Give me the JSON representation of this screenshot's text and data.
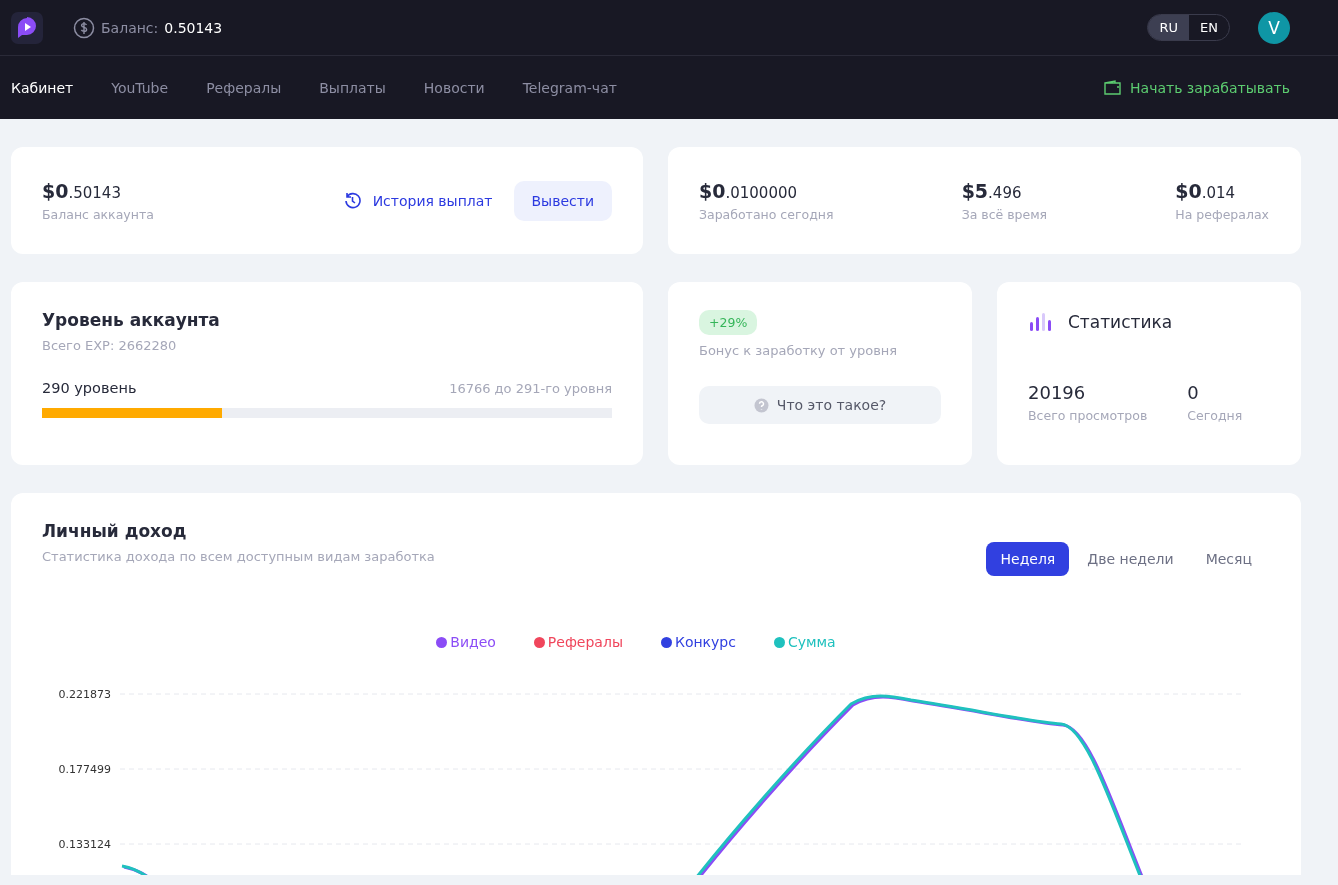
{
  "header": {
    "balance_label": "Баланс:",
    "balance_value": "0.50143",
    "languages": [
      {
        "label": "RU",
        "selected": true
      },
      {
        "label": "EN",
        "selected": false
      }
    ],
    "avatar": "V"
  },
  "nav": {
    "items": [
      {
        "label": "Кабинет",
        "selected": true
      },
      {
        "label": "YouTube",
        "selected": false
      },
      {
        "label": "Рефералы",
        "selected": false
      },
      {
        "label": "Выплаты",
        "selected": false
      },
      {
        "label": "Новости",
        "selected": false
      },
      {
        "label": "Telegram-чат",
        "selected": false
      }
    ],
    "cta": "Начать зарабатывать"
  },
  "balance_card": {
    "whole": "$0",
    "fraction": ".50143",
    "caption": "Баланс аккаунта",
    "history_link": "История выплат",
    "withdraw_button": "Вывести"
  },
  "earnings": [
    {
      "whole": "$0",
      "fraction": ".0100000",
      "caption": "Заработано сегодня"
    },
    {
      "whole": "$5",
      "fraction": ".496",
      "caption": "За всё время"
    },
    {
      "whole": "$0",
      "fraction": ".014",
      "caption": "На рефералах"
    }
  ],
  "level_card": {
    "title": "Уровень аккаунта",
    "exp": "Всего EXP: 2662280",
    "level_label": "290 уровень",
    "remaining": "16766 до 291-го уровня",
    "level": 0.316
  },
  "bonus_card": {
    "badge": "+29%",
    "caption": "Бонус к заработку от уровня",
    "help_button": "Что это такое?"
  },
  "stats_card": {
    "title": "Статистика",
    "items": [
      {
        "value": "20196",
        "caption": "Всего просмотров"
      },
      {
        "value": "0",
        "caption": "Сегодня"
      }
    ]
  },
  "income": {
    "title": "Личный доход",
    "subtitle": "Статистика дохода по всем доступным видам заработка",
    "periods": [
      {
        "label": "Неделя",
        "selected": true
      },
      {
        "label": "Две недели",
        "selected": false
      },
      {
        "label": "Месяц",
        "selected": false
      }
    ],
    "legend": [
      {
        "name": "Видео",
        "color": "#8b4cf6"
      },
      {
        "name": "Рефералы",
        "color": "#f0465c"
      },
      {
        "name": "Конкурс",
        "color": "#3140e0"
      },
      {
        "name": "Сумма",
        "color": "#1fc1be"
      }
    ],
    "y_axis_labels": [
      "0.221873",
      "0.177499",
      "0.133124"
    ]
  }
}
